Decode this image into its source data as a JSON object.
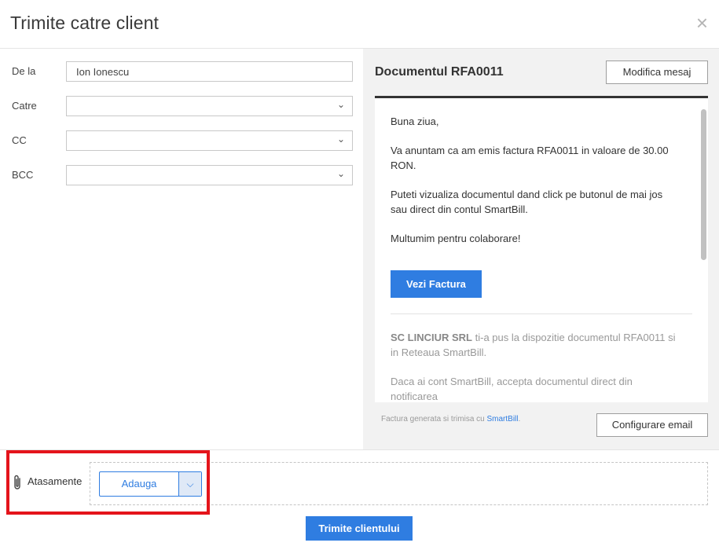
{
  "modal": {
    "title": "Trimite catre client",
    "close_icon": "×"
  },
  "form": {
    "from_label": "De la",
    "from_value": "Ion Ionescu",
    "to_label": "Catre",
    "to_value": "",
    "cc_label": "CC",
    "cc_value": "",
    "bcc_label": "BCC",
    "bcc_value": "",
    "chevron_icon": "⌄"
  },
  "preview": {
    "document_title": "Documentul RFA0011",
    "modify_button": "Modifica mesaj",
    "greeting": "Buna ziua,",
    "paragraph_1": "Va anuntam ca am emis factura RFA0011 in valoare de 30.00 RON.",
    "paragraph_2": "Puteti vizualiza documentul dand click pe butonul de mai jos sau direct din contul SmartBill.",
    "paragraph_3": "Multumim pentru colaborare!",
    "cta_button": "Vezi Factura",
    "footer_company": "SC LINCIUR SRL",
    "footer_text_1": " ti-a pus la dispozitie documentul RFA0011 si in Reteaua SmartBill.",
    "footer_text_2": "Daca ai cont SmartBill, accepta documentul direct din notificarea",
    "generated_note": "Factura generata si trimisa cu ",
    "generated_brand": "SmartBill",
    "generated_end": ".",
    "config_button": "Configurare email"
  },
  "attachments": {
    "label": "Atasamente",
    "add_button": "Adauga",
    "caret_icon": "⌵"
  },
  "actions": {
    "send_button": "Trimite clientului"
  },
  "colors": {
    "accent": "#2f7de1",
    "highlight": "#e4141b"
  }
}
